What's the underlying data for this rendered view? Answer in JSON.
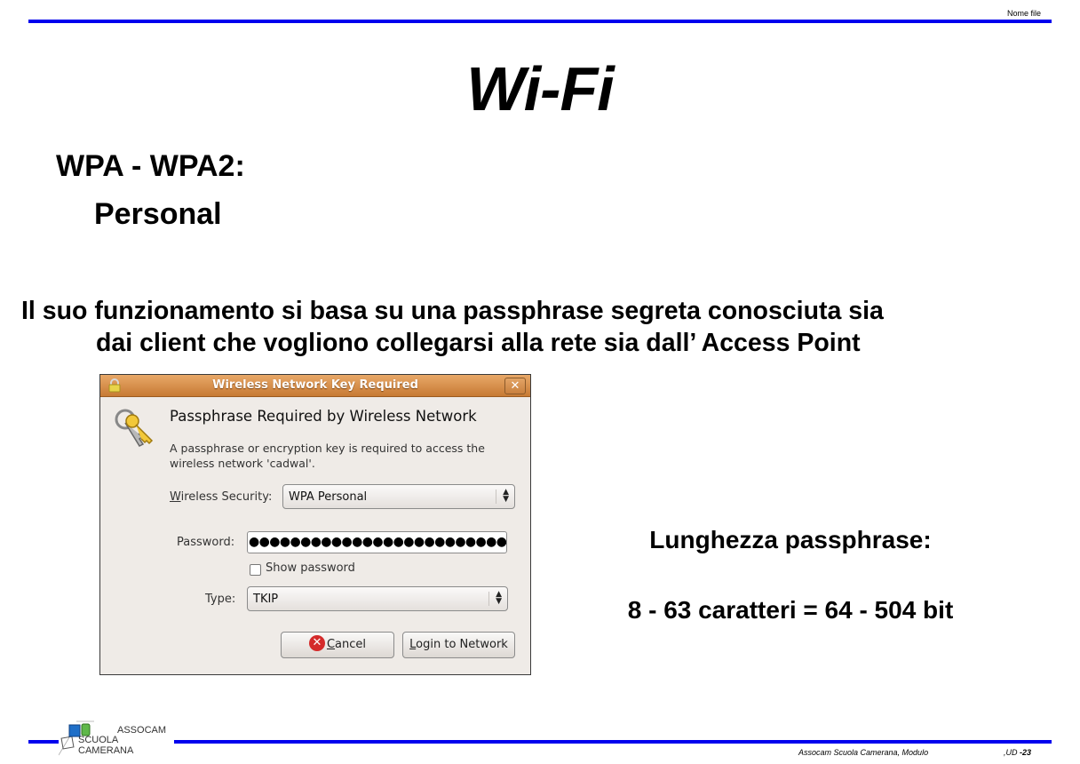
{
  "header": {
    "file_label": "Nome file"
  },
  "slide": {
    "title": "Wi-Fi",
    "heading_line1": "WPA - WPA2:",
    "heading_line2": "Personal",
    "paragraph_line1": "Il suo funzionamento si basa su una passphrase segreta conosciuta sia",
    "paragraph_line2": "dai client che vogliono collegarsi alla rete sia dall’ Access Point",
    "side_heading": "Lunghezza passphrase:",
    "side_detail": "8 - 63 caratteri = 64 - 504 bit"
  },
  "dialog": {
    "window_title": "Wireless Network Key Required",
    "close_glyph": "✕",
    "heading": "Passphrase Required by Wireless Network",
    "description": "A passphrase or encryption key is required to access the wireless network 'cadwal'.",
    "security_label_mnemonic": "W",
    "security_label_rest": "ireless Security:",
    "security_value": "WPA Personal",
    "password_label": "Password:",
    "password_value": "●●●●●●●●●●●●●●●●●●●●●●●●●",
    "show_password_label": "Show password",
    "show_password_checked": false,
    "type_label": "Type:",
    "type_value": "TKIP",
    "combo_arrows": "▲▼",
    "cancel_icon": "✕",
    "cancel_mnemonic": "C",
    "cancel_rest": "ancel",
    "login_mnemonic": "L",
    "login_rest": "ogin to Network",
    "titlebar_color": "#d08840"
  },
  "footer": {
    "logo_line1": "ASSOCAM",
    "logo_line2": "SCUOLA CAMERANA",
    "left_text": "Assocam Scuola Camerana, Modulo",
    "page_prefix": ",UD ",
    "page_number": "-23",
    "rule_color": "#0000ee"
  }
}
